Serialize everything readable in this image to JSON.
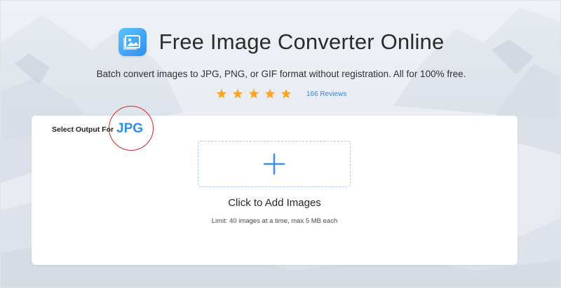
{
  "header": {
    "title": "Free Image Converter Online",
    "logo_icon": "image-gallery-icon"
  },
  "subtitle": "Batch convert images to JPG, PNG, or GIF format without registration. All for 100% free.",
  "rating": {
    "stars": 5,
    "star_color": "#f7a823",
    "reviews_text": "166 Reviews"
  },
  "converter": {
    "output_label": "Select Output For",
    "output_format": "JPG",
    "add_images_label": "Click to Add Images",
    "limit_text": "Limit: 40 images at a time, max 5 MB each",
    "add_icon": "plus-icon"
  },
  "colors": {
    "accent": "#2d8fe8",
    "link": "#3b82d6",
    "highlight": "#d8232a"
  }
}
